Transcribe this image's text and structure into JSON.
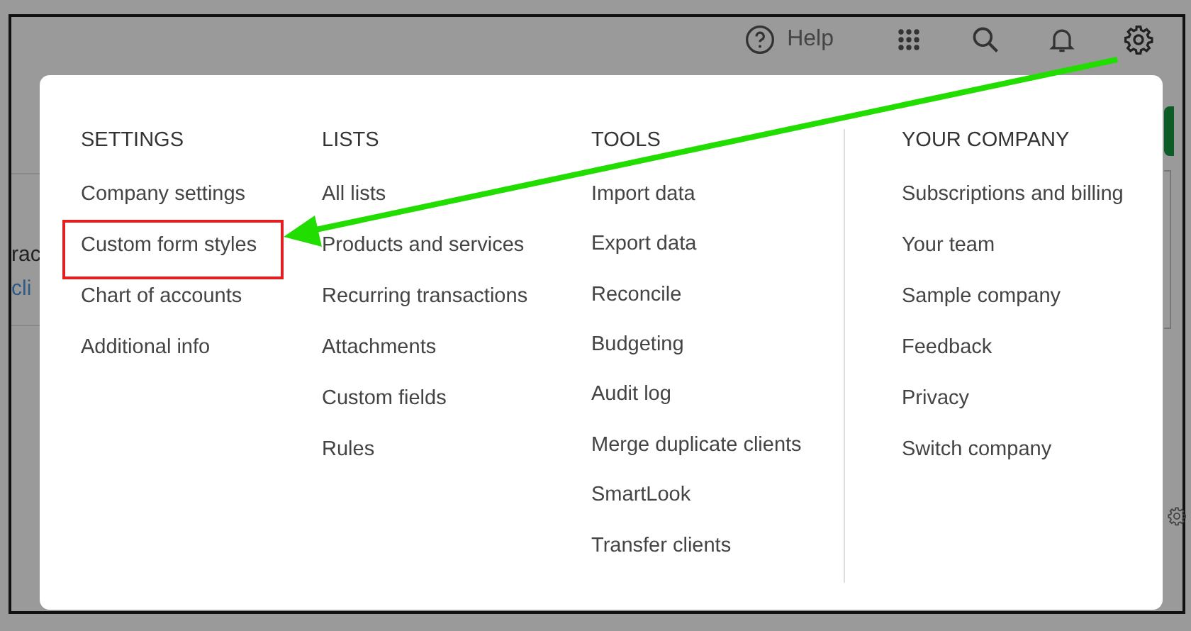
{
  "top_bar": {
    "help_label": "Help"
  },
  "background_fragments": [
    "rac",
    "cli"
  ],
  "menu": {
    "columns": [
      {
        "heading": "SETTINGS",
        "items": [
          {
            "label": "Company settings",
            "highlighted": false
          },
          {
            "label": "Custom form styles",
            "highlighted": true
          },
          {
            "label": "Chart of accounts",
            "highlighted": false
          },
          {
            "label": "Additional info",
            "highlighted": false
          }
        ]
      },
      {
        "heading": "LISTS",
        "items": [
          {
            "label": "All lists",
            "highlighted": false
          },
          {
            "label": "Products and services",
            "highlighted": false
          },
          {
            "label": "Recurring transactions",
            "highlighted": false
          },
          {
            "label": "Attachments",
            "highlighted": false
          },
          {
            "label": "Custom fields",
            "highlighted": false
          },
          {
            "label": "Rules",
            "highlighted": false
          }
        ]
      },
      {
        "heading": "TOOLS",
        "items": [
          {
            "label": "Import data",
            "highlighted": false
          },
          {
            "label": "Export data",
            "highlighted": false
          },
          {
            "label": "Reconcile",
            "highlighted": false
          },
          {
            "label": "Budgeting",
            "highlighted": false
          },
          {
            "label": "Audit log",
            "highlighted": false
          },
          {
            "label": "Merge duplicate clients",
            "highlighted": false
          },
          {
            "label": "SmartLook",
            "highlighted": false
          },
          {
            "label": "Transfer clients",
            "highlighted": false
          }
        ]
      },
      {
        "heading": "YOUR COMPANY",
        "items": [
          {
            "label": "Subscriptions and billing",
            "highlighted": false
          },
          {
            "label": "Your team",
            "highlighted": false
          },
          {
            "label": "Sample company",
            "highlighted": false
          },
          {
            "label": "Feedback",
            "highlighted": false
          },
          {
            "label": "Privacy",
            "highlighted": false
          },
          {
            "label": "Switch company",
            "highlighted": false
          }
        ]
      }
    ]
  }
}
